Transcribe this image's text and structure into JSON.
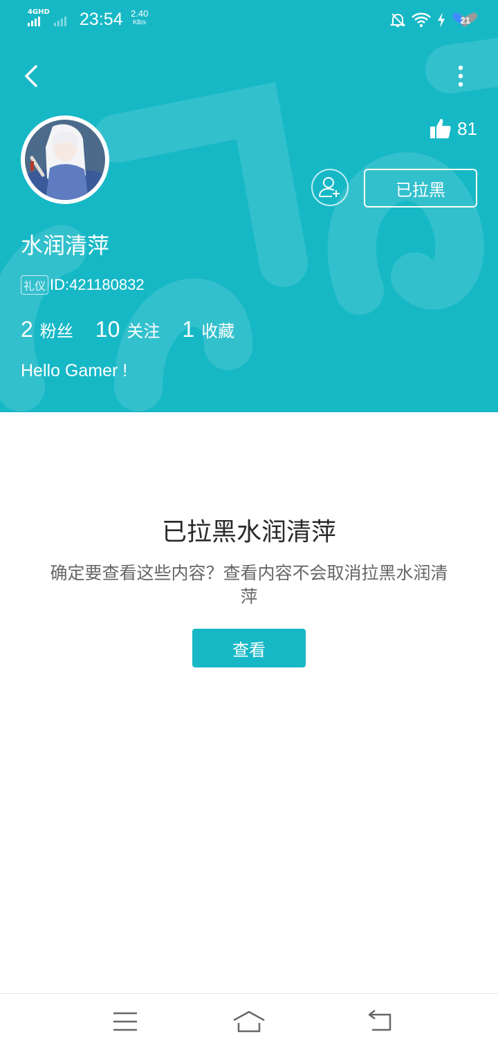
{
  "status_bar": {
    "network": "4GHD",
    "time": "23:54",
    "speed_value": "2.40",
    "speed_unit": "KB/s",
    "battery": "21"
  },
  "colors": {
    "accent": "#17b8c6",
    "header_bg": "#17b8c6",
    "text_dark": "#2a2a2a",
    "text_gray": "#666666"
  },
  "header": {
    "likes": "81",
    "blocked_button_label": "已拉黑",
    "username": "水润清萍",
    "badge": "礼仪",
    "user_id": "ID:421180832",
    "stats": [
      {
        "value": "2",
        "label": "粉丝"
      },
      {
        "value": "10",
        "label": "关注"
      },
      {
        "value": "1",
        "label": "收藏"
      }
    ],
    "bio": "Hello Gamer !"
  },
  "blocked_notice": {
    "title": "已拉黑水润清萍",
    "description": "确定要查看这些内容？查看内容不会取消拉黑水润清萍",
    "view_button_label": "查看"
  },
  "icons": {
    "back": "chevron-left-icon",
    "more": "more-vertical-icon",
    "like": "thumbs-up-icon",
    "follow": "add-user-icon",
    "nav_menu": "menu-icon",
    "nav_home": "home-icon",
    "nav_back": "return-icon"
  }
}
